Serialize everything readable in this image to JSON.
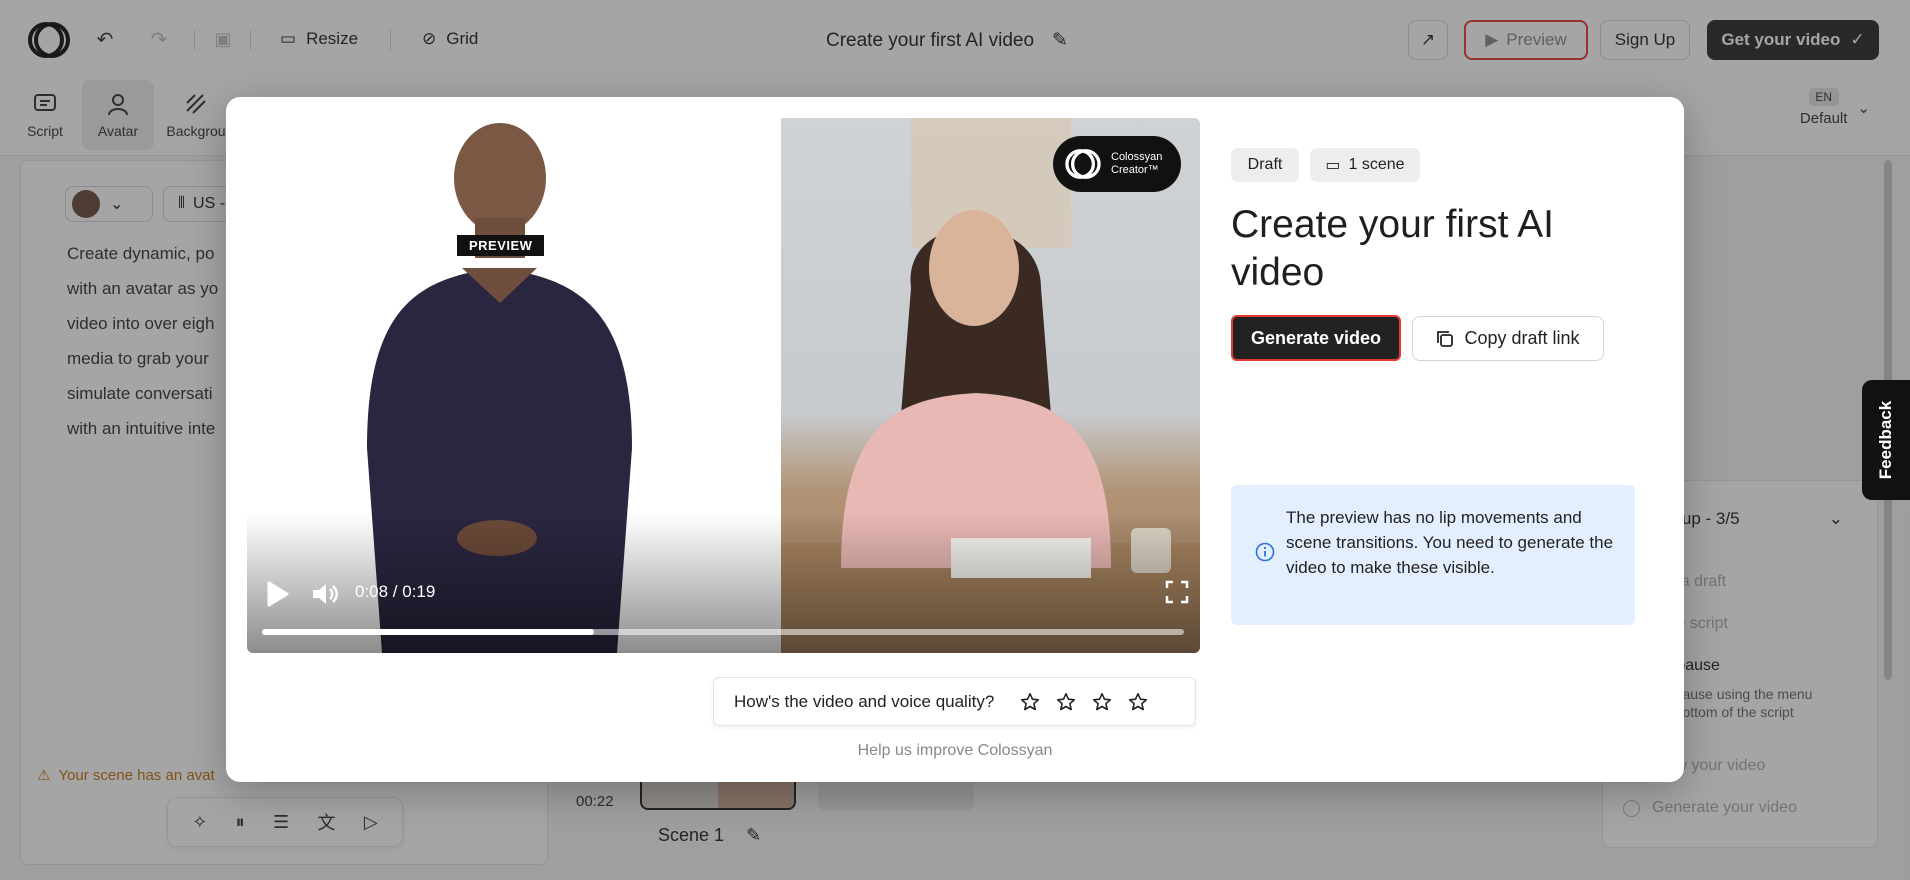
{
  "topbar": {
    "resize_label": "Resize",
    "grid_label": "Grid",
    "doc_title": "Create your first AI video",
    "preview_label": "Preview",
    "signup_label": "Sign Up",
    "get_video_label": "Get your video"
  },
  "toolbar": {
    "items": [
      "Script",
      "Avatar",
      "Backgrou"
    ],
    "lang_badge": "EN",
    "lang_label": "Default"
  },
  "editor": {
    "voice_label": "US -",
    "script_lines": [
      "Create dynamic, po",
      "with an avatar as yo",
      "video into over eigh",
      "media to grab your",
      "simulate conversati",
      "with an intuitive inte"
    ],
    "warning": "Your scene has an avat",
    "timeline_time": "00:22",
    "scene_label": "Scene 1"
  },
  "checklist": {
    "header": "et up - 3/5",
    "items": [
      "te a draft",
      "the script",
      "a pause",
      "a pause using the menu",
      "e bottom of the script",
      "iew your video",
      "Generate your video"
    ]
  },
  "feedback_tab": "Feedback",
  "modal": {
    "video": {
      "preview_tag": "PREVIEW",
      "brand_line1": "Colossyan",
      "brand_line2": "Creator™",
      "time": "0:08 / 0:19",
      "progress": 0.36
    },
    "tag_draft": "Draft",
    "tag_scenes": "1 scene",
    "title": "Create your first AI video",
    "generate_label": "Generate video",
    "copy_label": "Copy draft link",
    "info_text": "The preview has no lip movements and scene transitions. You need to generate the video to make these visible.",
    "rating_question": "How's the video and voice quality?",
    "rating_stars": 4,
    "help_text": "Help us improve Colossyan"
  },
  "colors": {
    "accent_red": "#e53935",
    "dark_button": "#222222",
    "info_bg": "#e3efff"
  }
}
